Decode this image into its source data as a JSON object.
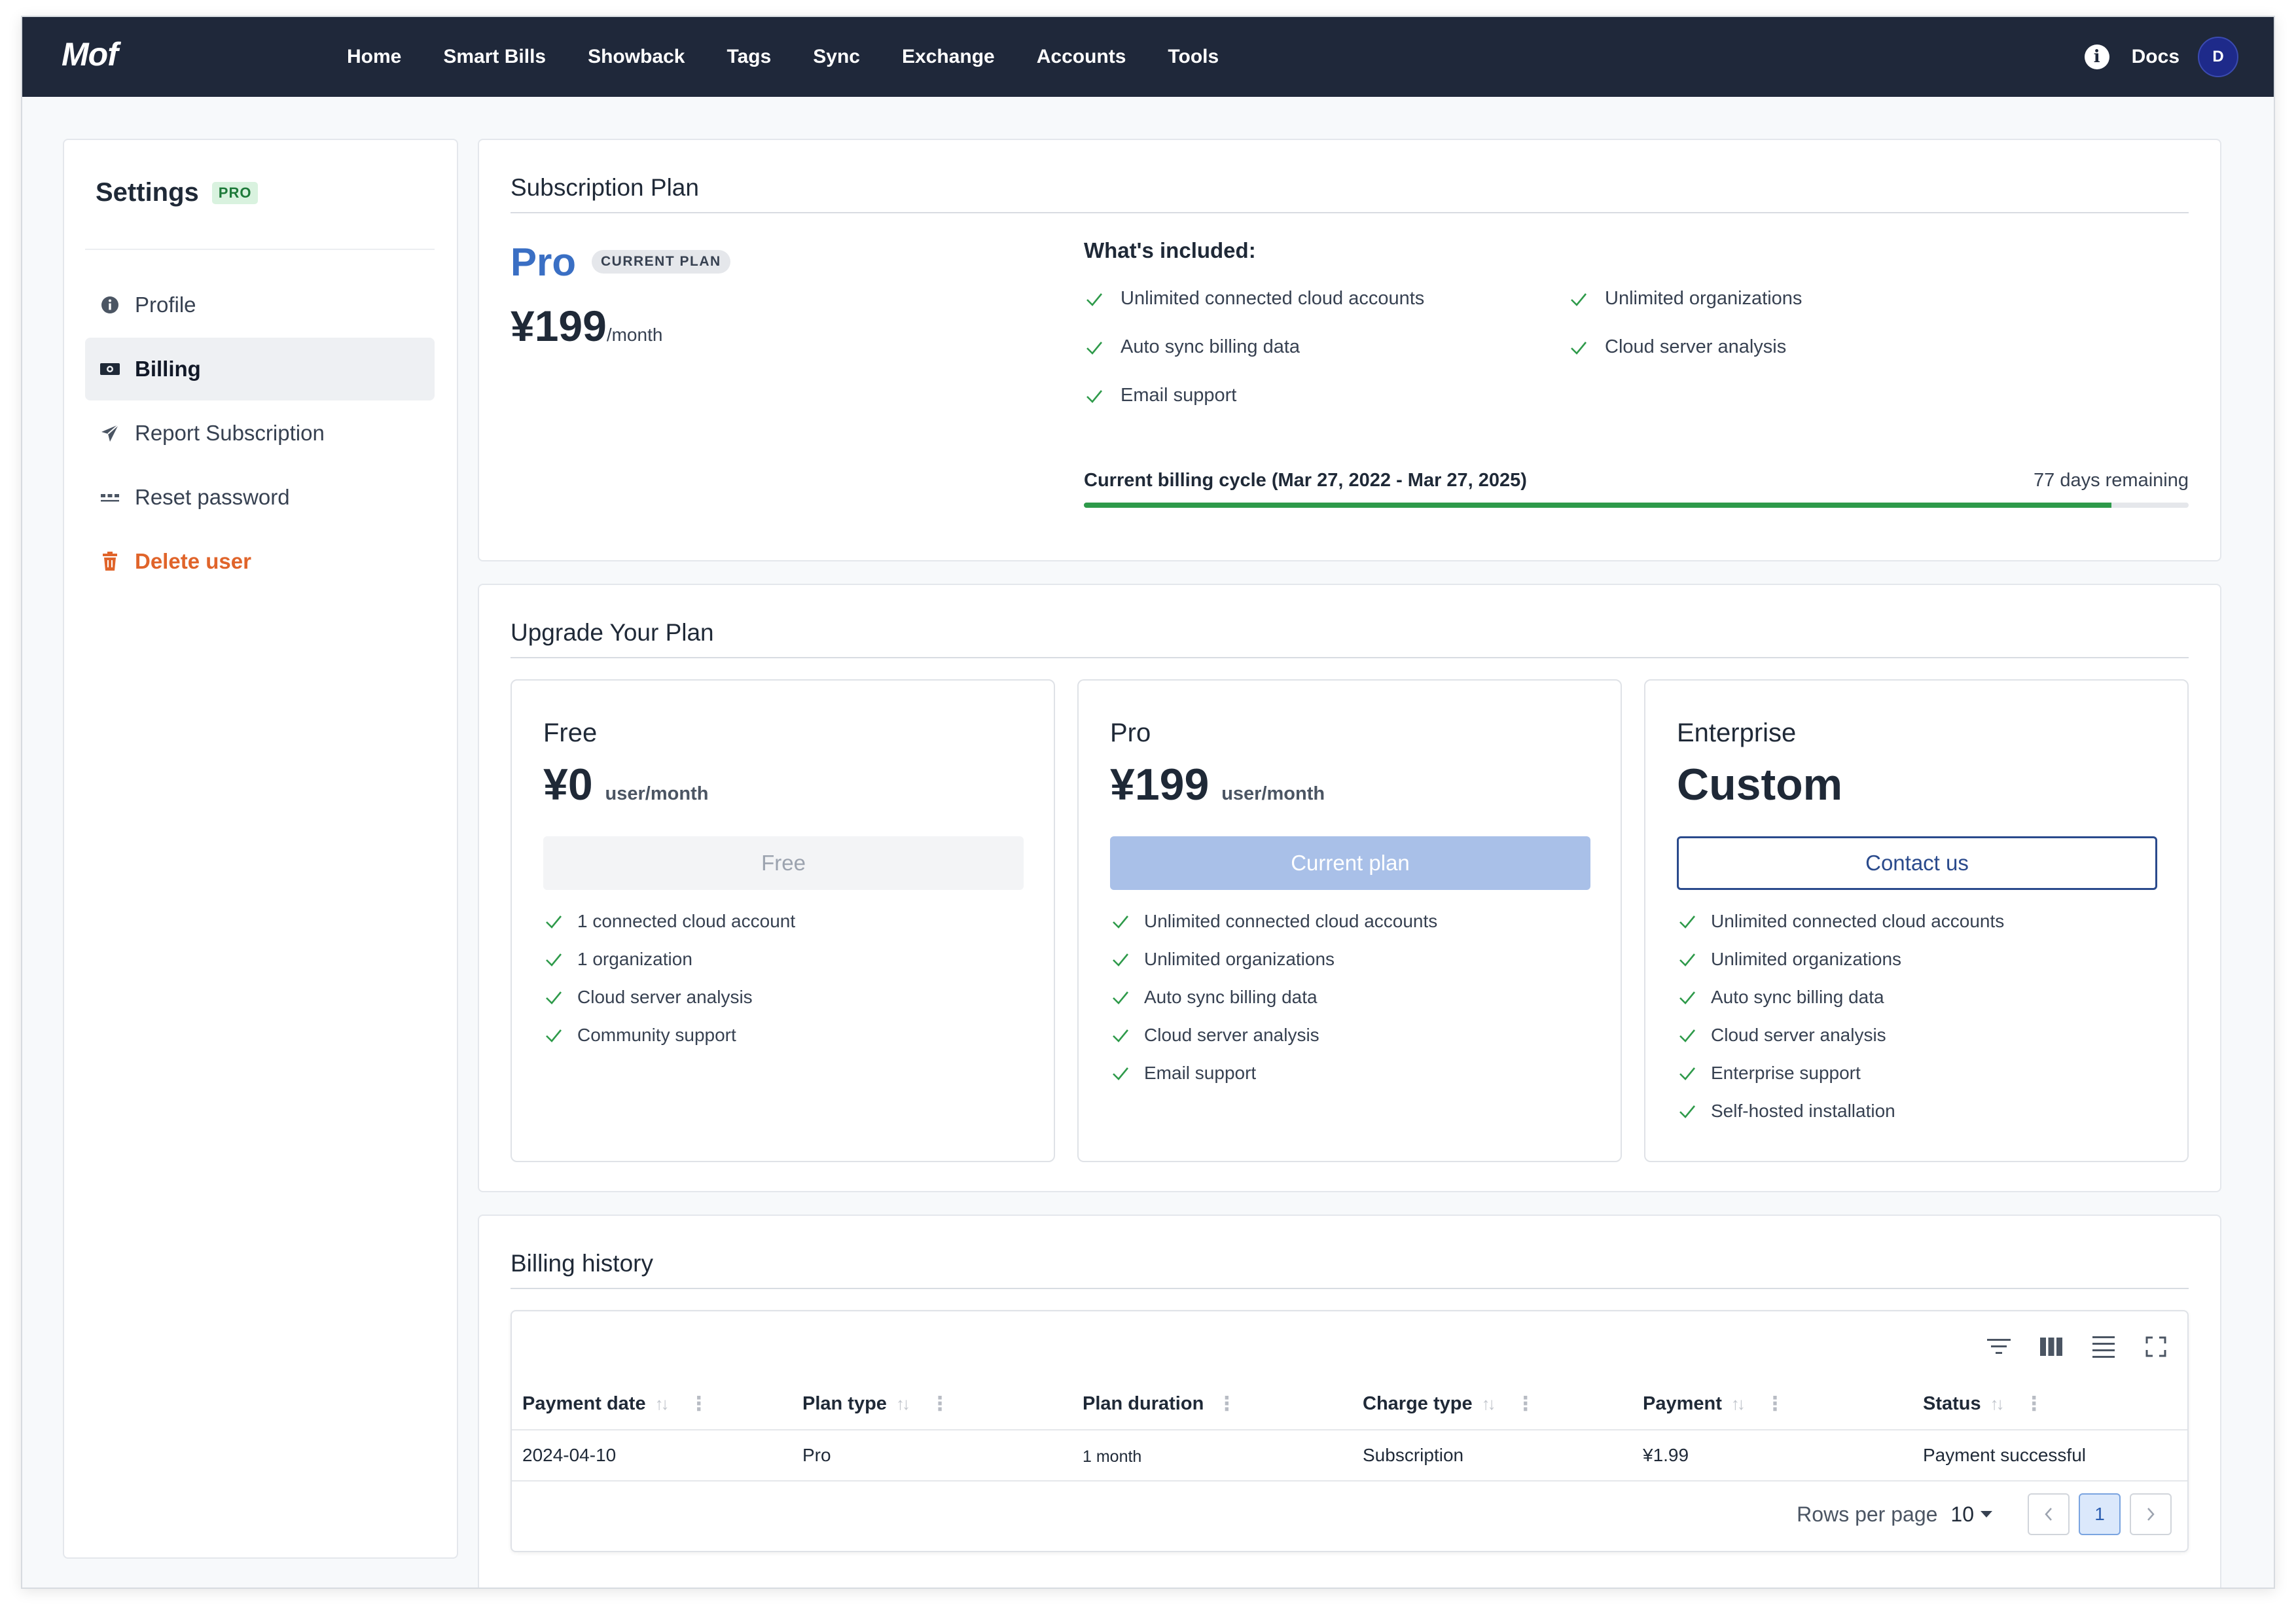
{
  "app": {
    "logo": "Mof"
  },
  "nav": {
    "items": [
      "Home",
      "Smart Bills",
      "Showback",
      "Tags",
      "Sync",
      "Exchange",
      "Accounts",
      "Tools"
    ],
    "docs": "Docs",
    "avatar": "D"
  },
  "sidebar": {
    "title": "Settings",
    "badge": "PRO",
    "items": [
      {
        "label": "Profile",
        "icon": "info-circle-icon"
      },
      {
        "label": "Billing",
        "icon": "money-icon",
        "active": true
      },
      {
        "label": "Report Subscription",
        "icon": "paper-plane-icon"
      },
      {
        "label": "Reset password",
        "icon": "password-dots-icon"
      },
      {
        "label": "Delete user",
        "icon": "trash-icon",
        "danger": true
      }
    ]
  },
  "subscription": {
    "title": "Subscription Plan",
    "plan_name": "Pro",
    "badge": "CURRENT PLAN",
    "price": "¥199",
    "per": "/month",
    "included_title": "What's included:",
    "features": [
      "Unlimited connected cloud accounts",
      "Unlimited organizations",
      "Auto sync billing data",
      "Cloud server analysis",
      "Email support"
    ],
    "cycle_label": "Current billing cycle (Mar 27, 2022 - Mar 27, 2025)",
    "cycle_remaining": "77 days remaining",
    "cycle_progress": 0.93,
    "accent": "#2e9a4a"
  },
  "upgrade": {
    "title": "Upgrade Your Plan",
    "plans": [
      {
        "name": "Free",
        "price": "¥0",
        "per": "user/month",
        "button": "Free",
        "features": [
          "1 connected cloud account",
          "1 organization",
          "Cloud server analysis",
          "Community support"
        ]
      },
      {
        "name": "Pro",
        "price": "¥199",
        "per": "user/month",
        "button": "Current plan",
        "features": [
          "Unlimited connected cloud accounts",
          "Unlimited organizations",
          "Auto sync billing data",
          "Cloud server analysis",
          "Email support"
        ]
      },
      {
        "name": "Enterprise",
        "price": "Custom",
        "per": "",
        "button": "Contact us",
        "features": [
          "Unlimited connected cloud accounts",
          "Unlimited organizations",
          "Auto sync billing data",
          "Cloud server analysis",
          "Enterprise support",
          "Self-hosted installation"
        ]
      }
    ]
  },
  "billing_history": {
    "title": "Billing history",
    "columns": [
      "Payment date",
      "Plan type",
      "Plan duration",
      "Charge type",
      "Payment",
      "Status"
    ],
    "rows": [
      [
        "2024-04-10",
        "Pro",
        "1 month",
        "Subscription",
        "¥1.99",
        "Payment successful"
      ]
    ],
    "rows_per_page_label": "Rows per page",
    "rows_per_page": "10",
    "page": "1"
  }
}
